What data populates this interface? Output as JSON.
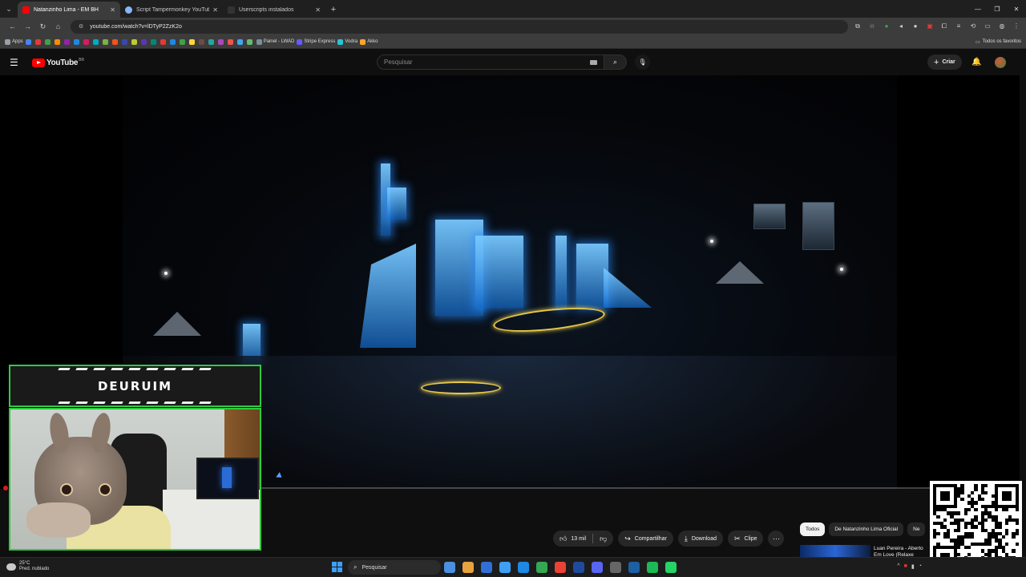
{
  "browser": {
    "tabs": [
      {
        "title": "Natanzinho Lima - EM BH",
        "active": true,
        "favicon_color": "#ff0000"
      },
      {
        "title": "Script Tampermonkey YouTube",
        "active": false,
        "favicon_color": "#8ab4f8"
      },
      {
        "title": "Userscripts instalados",
        "active": false,
        "favicon_color": "#333333"
      }
    ],
    "url": "youtube.com/watch?v=lDTyP2ZzK2o",
    "bookmarks": [
      {
        "label": "Apps",
        "color": "#9aa0a6"
      },
      {
        "label": "",
        "color": "#4285f4"
      },
      {
        "label": "",
        "color": "#e53935"
      },
      {
        "label": "",
        "color": "#43a047"
      },
      {
        "label": "",
        "color": "#fb8c00"
      },
      {
        "label": "",
        "color": "#8e24aa"
      },
      {
        "label": "",
        "color": "#1e88e5"
      },
      {
        "label": "",
        "color": "#d81b60"
      },
      {
        "label": "",
        "color": "#00acc1"
      },
      {
        "label": "",
        "color": "#7cb342"
      },
      {
        "label": "",
        "color": "#f4511e"
      },
      {
        "label": "",
        "color": "#3949ab"
      },
      {
        "label": "",
        "color": "#c0ca33"
      },
      {
        "label": "",
        "color": "#5e35b1"
      },
      {
        "label": "",
        "color": "#00897b"
      },
      {
        "label": "",
        "color": "#e53935"
      },
      {
        "label": "",
        "color": "#1e88e5"
      },
      {
        "label": "",
        "color": "#43a047"
      },
      {
        "label": "",
        "color": "#fdd835"
      },
      {
        "label": "",
        "color": "#6d4c41"
      },
      {
        "label": "",
        "color": "#26a69a"
      },
      {
        "label": "",
        "color": "#ab47bc"
      },
      {
        "label": "",
        "color": "#ef5350"
      },
      {
        "label": "",
        "color": "#42a5f5"
      },
      {
        "label": "",
        "color": "#66bb6a"
      },
      {
        "label": "Painel - LWAD",
        "color": "#78909c"
      },
      {
        "label": "Stripe Express",
        "color": "#635bff"
      },
      {
        "label": "Vodra",
        "color": "#26c6da"
      },
      {
        "label": "Akko",
        "color": "#ffa726"
      }
    ],
    "all_bookmarks_label": "Todos os favoritos"
  },
  "youtube": {
    "logo_text": "YouTube",
    "region": "BR",
    "search_placeholder": "Pesquisar",
    "create_label": "Criar",
    "progress_fraction": 0.0,
    "actions": {
      "likes": "13 mil",
      "share": "Compartilhar",
      "download": "Download",
      "clip": "Clipe"
    },
    "chips": [
      "Todos",
      "De Natanzinho Lima Oficial",
      "Ne"
    ],
    "recommendation_title": "Luan Pereira - Aberto Em Love (Relaxe"
  },
  "overlay": {
    "streamer_name": "DEURUIM",
    "frame_color": "#2ecc40"
  },
  "taskbar": {
    "temperature": "25°C",
    "weather": "Pred. nublado",
    "search_label": "Pesquisar",
    "apps": [
      "#4a90e2",
      "#e8a33d",
      "#2f6fd6",
      "#3da0f5",
      "#1e88e5",
      "#34a853",
      "#ea4335",
      "#1f4b9e",
      "#5865f2",
      "#666666",
      "#1c5fa3",
      "#1db954",
      "#25d366"
    ]
  }
}
